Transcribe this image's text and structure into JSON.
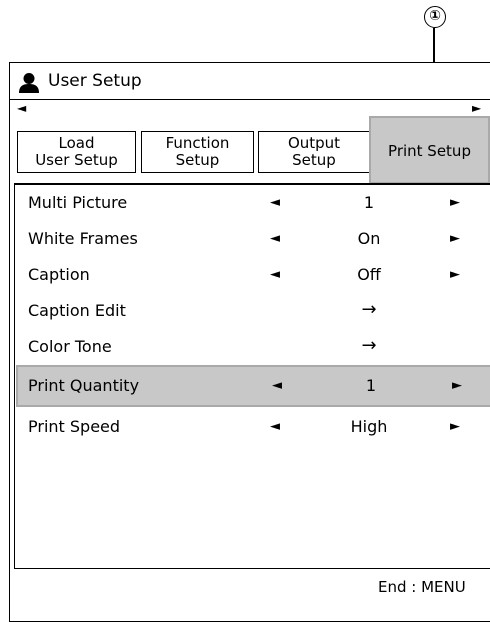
{
  "callout": {
    "number": "①"
  },
  "window": {
    "title": "User Setup"
  },
  "tabs": [
    {
      "line1": "Load",
      "line2": "User Setup"
    },
    {
      "line1": "Function",
      "line2": "Setup"
    },
    {
      "line1": "Output",
      "line2": "Setup"
    },
    {
      "label": "Print Setup",
      "active": true
    }
  ],
  "scroll": {
    "left": "◄",
    "right": "►"
  },
  "rows": [
    {
      "label": "Multi Picture",
      "value": "1"
    },
    {
      "label": "White Frames",
      "value": "On"
    },
    {
      "label": "Caption",
      "value": "Off"
    },
    {
      "label": "Caption Edit",
      "action": "→"
    },
    {
      "label": "Color Tone",
      "action": "→"
    },
    {
      "label": "Print Quantity",
      "value": "1",
      "selected": true
    },
    {
      "label": "Print Speed",
      "value": "High"
    }
  ],
  "arrows": {
    "left": "◄",
    "right": "►"
  },
  "footer": {
    "hint": "End : MENU"
  }
}
